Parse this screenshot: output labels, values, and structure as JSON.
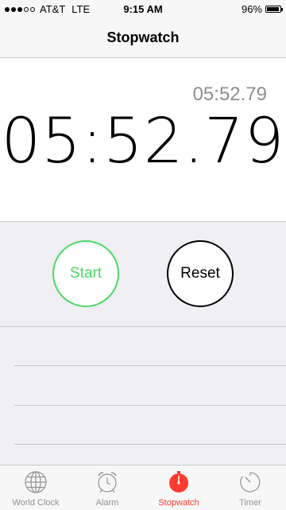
{
  "status_bar": {
    "carrier": "AT&T",
    "network": "LTE",
    "time": "9:15 AM",
    "battery": "96%",
    "battery_level": 0.96,
    "signal_bars": 3,
    "signal_total": 5
  },
  "nav": {
    "title": "Stopwatch"
  },
  "stopwatch": {
    "lap_time": "05:52.79",
    "main_time": "05:52.79"
  },
  "controls": {
    "start_label": "Start",
    "reset_label": "Reset"
  },
  "tabs": [
    {
      "label": "World Clock",
      "icon": "globe-icon",
      "active": false
    },
    {
      "label": "Alarm",
      "icon": "alarm-clock-icon",
      "active": false
    },
    {
      "label": "Stopwatch",
      "icon": "stopwatch-icon",
      "active": true
    },
    {
      "label": "Timer",
      "icon": "timer-icon",
      "active": false
    }
  ],
  "colors": {
    "start_green": "#4cd964",
    "active_red": "#ff3b30",
    "inactive_gray": "#929292"
  }
}
